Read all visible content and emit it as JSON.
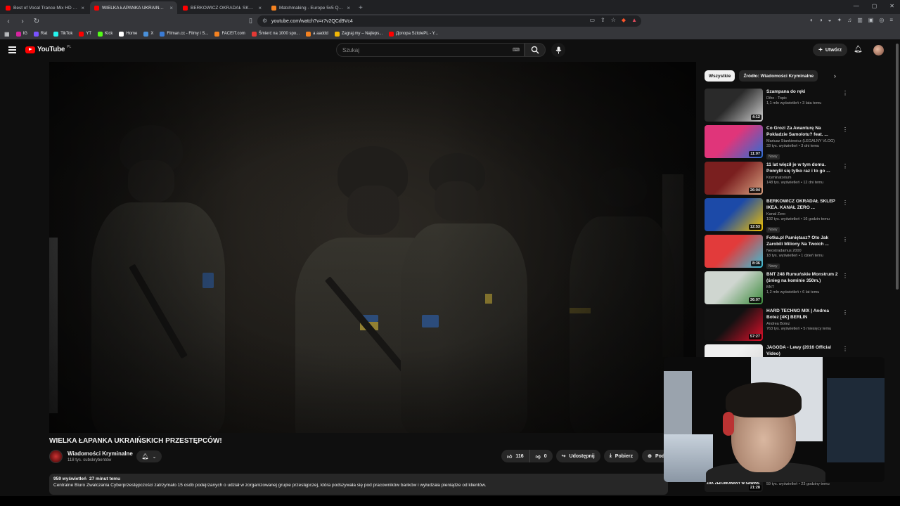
{
  "browser": {
    "tabs": [
      {
        "title": "Best of Vocal Trance Mix HD - YouTu...",
        "color": "#ff0000",
        "active": false
      },
      {
        "title": "WIELKA ŁAPANKA UKRAIŃSKI...",
        "color": "#ff0000",
        "active": true
      },
      {
        "title": "BERKOWICZ OKRADAŁ SKLEP IKEA. K...",
        "color": "#ff0000",
        "active": false
      },
      {
        "title": "Matchmaking - Europe 5v5 Queue",
        "color": "#f58220",
        "active": false
      }
    ],
    "url": "youtube.com/watch?v=r7v2QCd9Vc4",
    "bookmarks": [
      {
        "label": "IG",
        "color": "#d6249f"
      },
      {
        "label": "Rat",
        "color": "#7a52ff"
      },
      {
        "label": "TikTok",
        "color": "#25f4ee"
      },
      {
        "label": "YT",
        "color": "#ff0000"
      },
      {
        "label": "Kick",
        "color": "#53fc18"
      },
      {
        "label": "Home",
        "color": "#ffffff"
      },
      {
        "label": "X",
        "color": "#4a90d9"
      },
      {
        "label": "Filman.cc - Filmy i S...",
        "color": "#3a7bd5"
      },
      {
        "label": "FACEIT.com",
        "color": "#f58220"
      },
      {
        "label": "Śmierć na 1000 spo...",
        "color": "#e53935"
      },
      {
        "label": "a aaddd",
        "color": "#f58220"
      },
      {
        "label": "Zagraj.my – Najleps...",
        "color": "#f2b705"
      },
      {
        "label": "Допора SztolePL - Y...",
        "color": "#ff0000"
      }
    ]
  },
  "header": {
    "logo_text": "YouTube",
    "country": "PL",
    "search_placeholder": "Szukaj",
    "create_label": "Utwórz"
  },
  "video": {
    "title": "WIELKA ŁAPANKA UKRAIŃSKICH PRZESTĘPCÓW!",
    "channel": "Wiadomości Kryminalne",
    "subscribers": "118 tys. subskrybentów",
    "likes": "116",
    "dislikes": "0",
    "share_label": "Udostępnij",
    "download_label": "Pobierz",
    "support_label": "Podz",
    "views": "959 wyświetleń",
    "age": "27 minut temu",
    "description": "Centralne Biuro Zwalczania Cyberprzestępczości zatrzymało 15 osób podejrzanych o udział w zorganizowanej grupie przestępczej, która podszywała się pod pracowników banków i wyłudzała pieniądze od klientów."
  },
  "sidebar": {
    "chips": [
      "Wszystkie",
      "Źródło: Wiadomości Kryminalne"
    ],
    "recommendations": [
      {
        "title": "Szampana do ręki",
        "channel": "Diho - Topic",
        "meta": "1,1 mln wyświetleń • 3 lata temu",
        "duration": "4:12",
        "new": false,
        "colors": [
          "#2a2a2a",
          "#cfcfcf"
        ]
      },
      {
        "title": "Co Grozi Za Awanturę Na Pokładzie Samolotu? feat. ...",
        "channel": "Mariusz Stankiewicz (LEGALNY VLOG)",
        "meta": "33 tys. wyświetleń • 3 dni temu",
        "duration": "11:07",
        "new": true,
        "colors": [
          "#e0357a",
          "#2a6fd6"
        ]
      },
      {
        "title": "11 lat więził je w tym domu. Pomylił się tylko raz i to go ...",
        "channel": "Kryminatorium",
        "meta": "148 tys. wyświetleń • 12 dni temu",
        "duration": "26:04",
        "new": false,
        "colors": [
          "#7a1f1f",
          "#d8a080"
        ]
      },
      {
        "title": "BERKOWICZ OKRADAŁ SKLEP IKEA. KANAŁ ZERO ...",
        "channel": "Kanał Zero",
        "meta": "192 tys. wyświetleń • 16 godzin temu",
        "duration": "12:53",
        "new": true,
        "colors": [
          "#1c4aa8",
          "#f2c200"
        ]
      },
      {
        "title": "Fotka.pl Pamiętasz? Oto Jak Zarobili Miliony Na Twoich ...",
        "channel": "Neostradamus 2000",
        "meta": "18 tys. wyświetleń • 1 dzień temu",
        "duration": "8:36",
        "new": true,
        "colors": [
          "#e23b3b",
          "#3ac0d8"
        ]
      },
      {
        "title": "BNT 248 Rumuńskie Monstrum 2 (śnieg na kominie 350m.)",
        "channel": "BNT",
        "meta": "1,2 mln wyświetleń • 6 lat temu",
        "duration": "36:07",
        "new": false,
        "colors": [
          "#cfd6d0",
          "#3b8a3b"
        ]
      },
      {
        "title": "HARD TECHNO MIX | Andrea Botez [4K] BERLIN",
        "channel": "Andrea Botez",
        "meta": "763 tys. wyświetleń • 5 miesięcy temu",
        "duration": "57:27",
        "new": false,
        "colors": [
          "#111111",
          "#e0102a"
        ]
      },
      {
        "title": "JAGODA - Lewy (2016 Official Video)",
        "channel": "",
        "meta": "",
        "duration": "",
        "new": false,
        "colors": [
          "#f0f0f0",
          "#d8d8d8"
        ]
      }
    ],
    "bottom_item": {
      "thumb_text": "ZAK ZEŁOMOWANY W SAWINS",
      "meta": "59 tys. wyświetleń • 23 godziny temu",
      "duration": "21:28"
    }
  }
}
